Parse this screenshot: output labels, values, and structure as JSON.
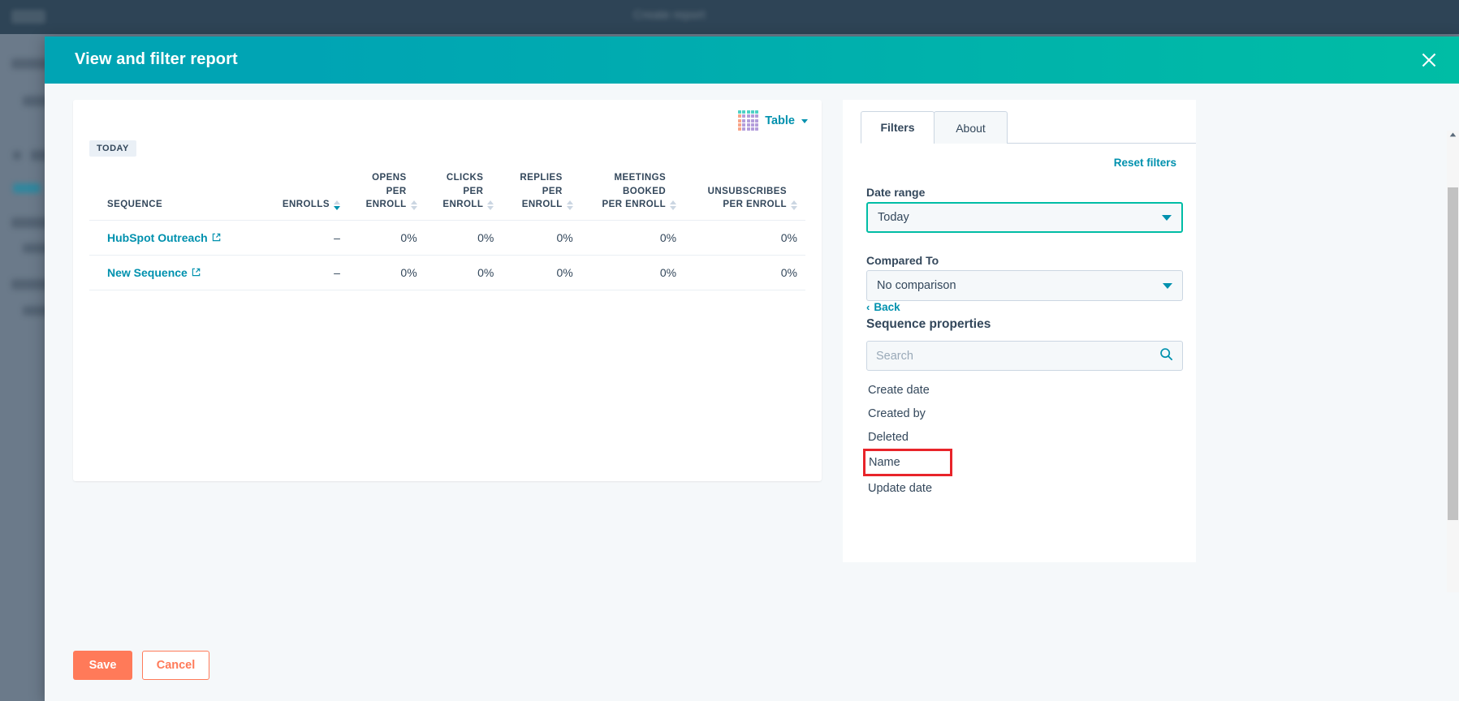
{
  "background": {
    "app_title": "Create report",
    "logo_alt": "hubspot-logo"
  },
  "modal": {
    "title": "View and filter report",
    "close_icon": "close-icon"
  },
  "report": {
    "viz_label": "Table",
    "viz_icon": "table-grid-icon",
    "date_badge": "TODAY",
    "columns": [
      {
        "label": "SEQUENCE",
        "sortable": false,
        "align": "left"
      },
      {
        "label": "ENROLLS",
        "sortable": true,
        "sorted": "desc",
        "align": "right"
      },
      {
        "label": "OPENS\nPER\nENROLL",
        "sortable": true,
        "align": "right"
      },
      {
        "label": "CLICKS\nPER\nENROLL",
        "sortable": true,
        "align": "right"
      },
      {
        "label": "REPLIES\nPER\nENROLL",
        "sortable": true,
        "align": "right"
      },
      {
        "label": "MEETINGS\nBOOKED\nPER ENROLL",
        "sortable": true,
        "align": "right"
      },
      {
        "label": "UNSUBSCRIBES\nPER ENROLL",
        "sortable": true,
        "align": "right"
      }
    ],
    "rows": [
      {
        "sequence": "HubSpot Outreach",
        "link_icon": "external-link-icon",
        "enrolls": "–",
        "opens_per_enroll": "0%",
        "clicks_per_enroll": "0%",
        "replies_per_enroll": "0%",
        "meetings_booked_per_enroll": "0%",
        "unsubscribes_per_enroll": "0%"
      },
      {
        "sequence": "New Sequence",
        "link_icon": "external-link-icon",
        "enrolls": "–",
        "opens_per_enroll": "0%",
        "clicks_per_enroll": "0%",
        "replies_per_enroll": "0%",
        "meetings_booked_per_enroll": "0%",
        "unsubscribes_per_enroll": "0%"
      }
    ]
  },
  "filters": {
    "tabs": [
      {
        "label": "Filters",
        "active": true
      },
      {
        "label": "About",
        "active": false
      }
    ],
    "reset_label": "Reset filters",
    "date_range": {
      "label": "Date range",
      "value": "Today",
      "focused": true
    },
    "compared_to": {
      "label": "Compared To",
      "value": "No comparison",
      "focused": false
    },
    "back_label": "Back",
    "back_chevron": "‹",
    "properties_title": "Sequence properties",
    "search_placeholder": "Search",
    "search_value": "",
    "search_icon": "search-icon",
    "properties": [
      {
        "label": "Create date",
        "highlighted": false
      },
      {
        "label": "Created by",
        "highlighted": false
      },
      {
        "label": "Deleted",
        "highlighted": false
      },
      {
        "label": "Name",
        "highlighted": true
      },
      {
        "label": "Update date",
        "highlighted": false
      }
    ]
  },
  "footer": {
    "save_label": "Save",
    "cancel_label": "Cancel"
  },
  "colors": {
    "header_gradient_start": "#00A4B4",
    "header_gradient_end": "#00BDA5",
    "link": "#0091AE",
    "primary_button": "#FF7A59",
    "text": "#33475B",
    "annotation": "#E8242A",
    "panel_bg": "#F5F8FA"
  }
}
